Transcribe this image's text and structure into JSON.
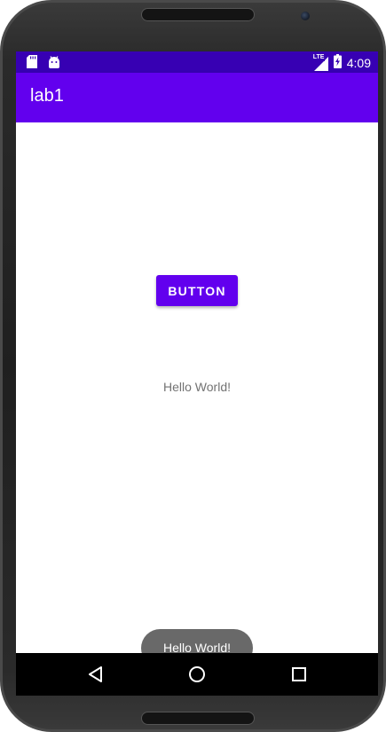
{
  "status_bar": {
    "time": "4:09",
    "network_label": "LTE",
    "icons": [
      "sd-card-icon",
      "android-icon",
      "lte-signal-icon",
      "battery-charging-icon"
    ]
  },
  "app_bar": {
    "title": "lab1"
  },
  "main": {
    "button_label": "BUTTON",
    "hello_text": "Hello World!"
  },
  "toast": {
    "message": "Hello World!"
  },
  "nav_bar": {
    "icons": [
      "back-icon",
      "home-icon",
      "recents-icon"
    ]
  },
  "colors": {
    "status_bar": "#3700b3",
    "app_bar": "#6200ee",
    "button": "#6200ee",
    "toast": "#696969",
    "nav_bar": "#000000"
  }
}
